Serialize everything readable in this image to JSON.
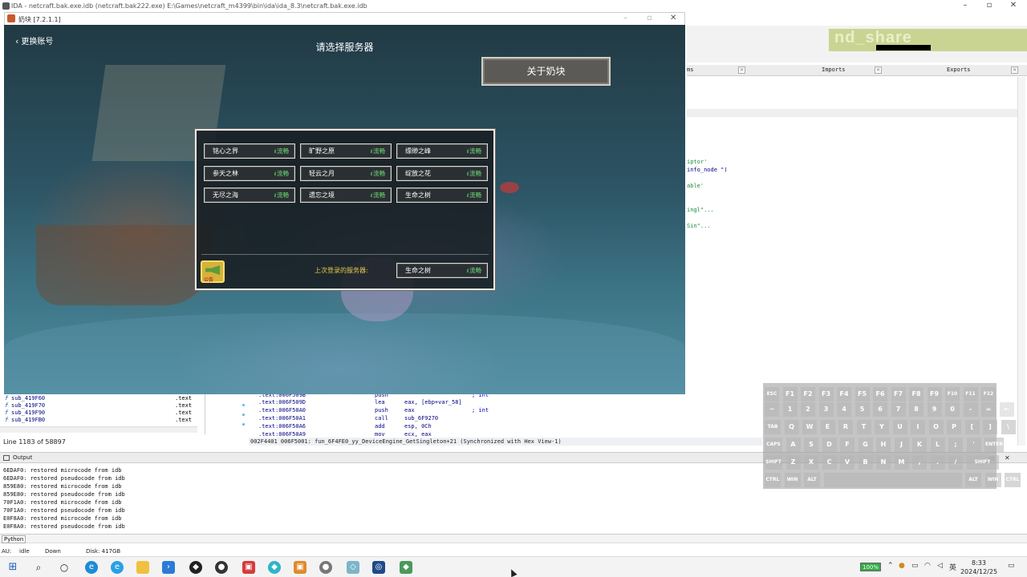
{
  "ida": {
    "window_title": "IDA - netcraft.bak.exe.idb (netcraft.bak222.exe) E:\\Games\\netcraft_m4399\\bin\\ida\\ida_8.3\\netcraft.bak.exe.idb",
    "banner_text": "nd_share",
    "tabs": [
      {
        "label": "ms"
      },
      {
        "label": "Imports"
      },
      {
        "label": "Exports"
      }
    ],
    "code_fragments": [
      "iptor'",
      "info_node \")",
      "able'",
      "ingl\"...",
      "Sin\"..."
    ],
    "functions": [
      {
        "name": "sub_419F60",
        "segment": ".text"
      },
      {
        "name": "sub_419F70",
        "segment": ".text"
      },
      {
        "name": "sub_419F90",
        "segment": ".text"
      },
      {
        "name": "sub_419FB0",
        "segment": ".text"
      }
    ],
    "line_status": "Line 1183 of 58897",
    "disasm": [
      {
        "addr": ".text:006F509B",
        "mnem": "push",
        "ops": "",
        "comment": "; int"
      },
      {
        "addr": ".text:006F509D",
        "mnem": "lea",
        "ops": "eax, [ebp+var_58]",
        "comment": ""
      },
      {
        "addr": ".text:006F50A0",
        "mnem": "push",
        "ops": "eax",
        "comment": "; int"
      },
      {
        "addr": ".text:006F50A1",
        "mnem": "call",
        "ops": "sub_6F9270",
        "comment": ""
      },
      {
        "addr": ".text:006F50A6",
        "mnem": "add",
        "ops": "esp, 0Ch",
        "comment": ""
      },
      {
        "addr": ".text:006F50A9",
        "mnem": "mov",
        "ops": "ecx, eax",
        "comment": ""
      }
    ],
    "address_bar": "002F4401 006F5001: fun_6F4FE0_yy_DeviceEngine_GetSingleton+21 (Synchronized with Hex View-1)",
    "output_title": "Output",
    "output_lines": [
      "6EDAF0: restored microcode from idb",
      "6EDAF0: restored pseudocode from idb",
      "859E80: restored microcode from idb",
      "859E80: restored pseudocode from idb",
      "70F1A0: restored microcode from idb",
      "70F1A0: restored pseudocode from idb",
      "E0F8A0: restored microcode from idb",
      "E0F8A0: restored pseudocode from idb"
    ],
    "python_label": "Python",
    "status": {
      "au": "AU:",
      "state": "idle",
      "dir": "Down",
      "disk": "Disk: 417GB"
    }
  },
  "keyboard": {
    "rows": [
      [
        "ESC",
        "F1",
        "F2",
        "F3",
        "F4",
        "F5",
        "F6",
        "F7",
        "F8",
        "F9",
        "F10",
        "F11",
        "F12"
      ],
      [
        "~",
        "1",
        "2",
        "3",
        "4",
        "5",
        "6",
        "7",
        "8",
        "9",
        "0",
        "-",
        "=",
        "←"
      ],
      [
        "TAB",
        "Q",
        "W",
        "E",
        "R",
        "T",
        "Y",
        "U",
        "I",
        "O",
        "P",
        "[",
        "]",
        "\\"
      ],
      [
        "CAPS",
        "A",
        "S",
        "D",
        "F",
        "G",
        "H",
        "J",
        "K",
        "L",
        ";",
        "'",
        "ENTER"
      ],
      [
        "SHIFT",
        "Z",
        "X",
        "C",
        "V",
        "B",
        "N",
        "M",
        ",",
        ".",
        "/",
        "SHIFT"
      ],
      [
        "CTRL",
        "WIN",
        "ALT",
        "",
        "ALT",
        "WIN",
        "CTRL"
      ]
    ]
  },
  "game": {
    "window_title": "奶块 [7.2.1.1]",
    "back_label": "更换账号",
    "title": "请选择服务器",
    "about_button": "关于奶块",
    "status_bars": "ıl",
    "servers": [
      {
        "name": "铭心之界",
        "status": "流畅"
      },
      {
        "name": "旷野之原",
        "status": "流畅"
      },
      {
        "name": "缥缈之峰",
        "status": "流畅"
      },
      {
        "name": "参天之林",
        "status": "流畅"
      },
      {
        "name": "轻云之月",
        "status": "流畅"
      },
      {
        "name": "绽放之花",
        "status": "流畅"
      },
      {
        "name": "无尽之海",
        "status": "流畅"
      },
      {
        "name": "遗忘之境",
        "status": "流畅"
      },
      {
        "name": "生命之树",
        "status": "流畅"
      }
    ],
    "notice_label": "公告",
    "last_login_label": "上次登录的服务器:",
    "last_server": {
      "name": "生命之树",
      "status": "流畅"
    }
  },
  "taskbar": {
    "battery": "100%",
    "ime": "英",
    "time": "8:33",
    "date": "2024/12/25"
  }
}
